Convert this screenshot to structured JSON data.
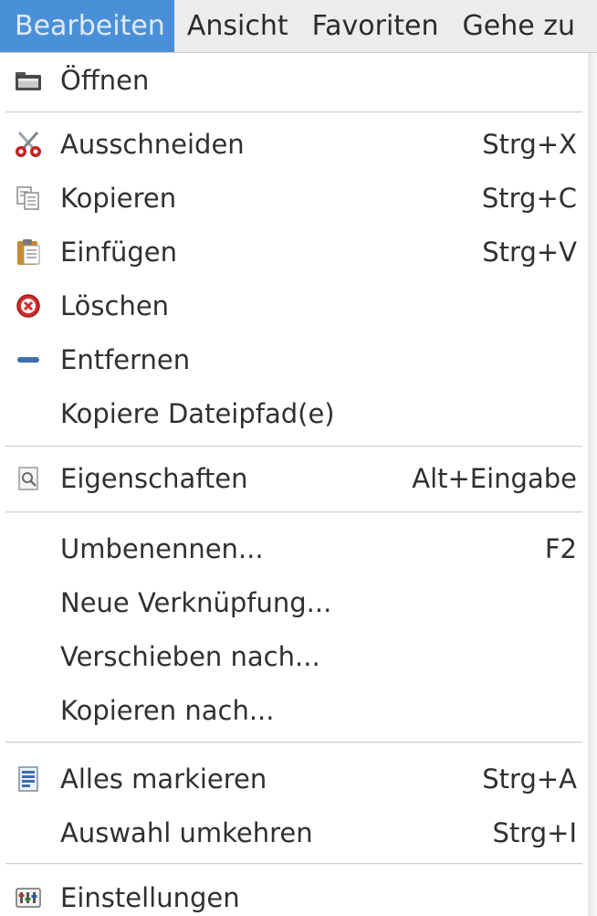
{
  "menubar": {
    "items": [
      {
        "label": "Bearbeiten"
      },
      {
        "label": "Ansicht"
      },
      {
        "label": "Favoriten"
      },
      {
        "label": "Gehe zu"
      }
    ]
  },
  "menu": {
    "items": [
      {
        "label": "Öffnen",
        "shortcut": "",
        "icon": "folder-open-icon"
      },
      {
        "label": "Ausschneiden",
        "shortcut": "Strg+X",
        "icon": "scissors-icon"
      },
      {
        "label": "Kopieren",
        "shortcut": "Strg+C",
        "icon": "copy-icon"
      },
      {
        "label": "Einfügen",
        "shortcut": "Strg+V",
        "icon": "paste-icon"
      },
      {
        "label": "Löschen",
        "shortcut": "",
        "icon": "delete-icon"
      },
      {
        "label": "Entfernen",
        "shortcut": "",
        "icon": "remove-icon"
      },
      {
        "label": "Kopiere Dateipfad(e)",
        "shortcut": "",
        "icon": ""
      },
      {
        "label": "Eigenschaften",
        "shortcut": "Alt+Eingabe",
        "icon": "properties-icon"
      },
      {
        "label": "Umbenennen...",
        "shortcut": "F2",
        "icon": ""
      },
      {
        "label": "Neue Verknüpfung...",
        "shortcut": "",
        "icon": ""
      },
      {
        "label": "Verschieben nach...",
        "shortcut": "",
        "icon": ""
      },
      {
        "label": "Kopieren nach...",
        "shortcut": "",
        "icon": ""
      },
      {
        "label": "Alles markieren",
        "shortcut": "Strg+A",
        "icon": "select-all-icon"
      },
      {
        "label": "Auswahl umkehren",
        "shortcut": "Strg+I",
        "icon": ""
      },
      {
        "label": "Einstellungen",
        "shortcut": "",
        "icon": "preferences-icon"
      }
    ]
  },
  "colors": {
    "menubar_active_bg": "#4a90d9",
    "text": "#303030",
    "separator": "#cdcdcd"
  }
}
